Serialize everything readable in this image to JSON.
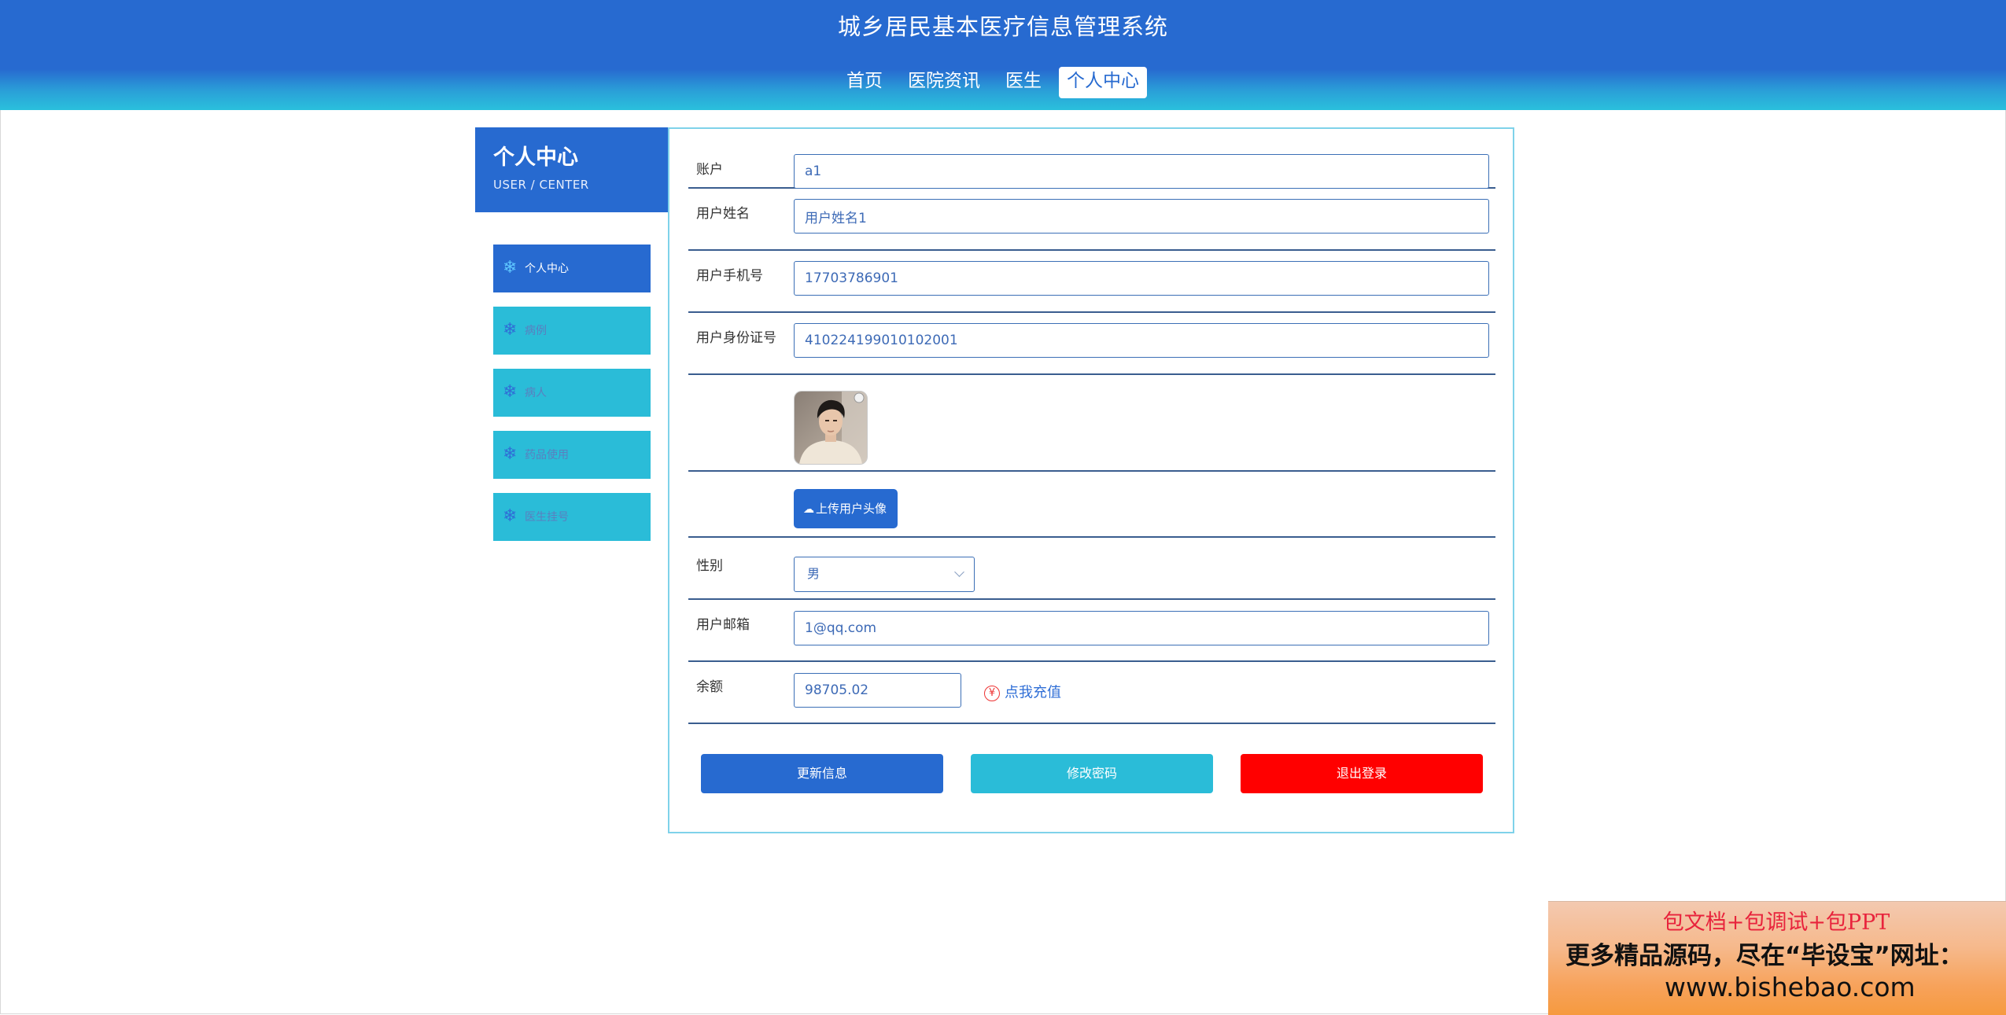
{
  "header": {
    "title": "城乡居民基本医疗信息管理系统",
    "nav": [
      {
        "label": "首页",
        "active": false
      },
      {
        "label": "医院资讯",
        "active": false
      },
      {
        "label": "医生",
        "active": false
      },
      {
        "label": "个人中心",
        "active": true
      }
    ]
  },
  "sidebar": {
    "title": "个人中心",
    "subtitle": "USER / CENTER",
    "items": [
      {
        "label": "个人中心",
        "icon": "snowflake-icon",
        "active": true
      },
      {
        "label": "病例",
        "icon": "snowflake-icon",
        "active": false
      },
      {
        "label": "病人",
        "icon": "snowflake-icon",
        "active": false
      },
      {
        "label": "药品使用",
        "icon": "snowflake-icon",
        "active": false
      },
      {
        "label": "医生挂号",
        "icon": "snowflake-icon",
        "active": false
      }
    ]
  },
  "form": {
    "account_label": "账户",
    "account_value": "a1",
    "name_label": "用户姓名",
    "name_value": "用户姓名1",
    "phone_label": "用户手机号",
    "phone_value": "17703786901",
    "idcard_label": "用户身份证号",
    "idcard_value": "410224199010102001",
    "upload_label": "上传用户头像",
    "gender_label": "性别",
    "gender_value": "男",
    "email_label": "用户邮箱",
    "email_value": "1@qq.com",
    "balance_label": "余额",
    "balance_value": "98705.02",
    "recharge_symbol": "¥",
    "recharge_label": "点我充值"
  },
  "buttons": {
    "update": "更新信息",
    "change_password": "修改密码",
    "logout": "退出登录"
  },
  "ad": {
    "line1": "包文档+包调试+包PPT",
    "line2": "更多精品源码，尽在“毕设宝”网址：",
    "line3": "www.bishebao.com"
  },
  "colors": {
    "primary": "#276ad0",
    "accent": "#2abcd8",
    "danger": "#ff0000"
  }
}
